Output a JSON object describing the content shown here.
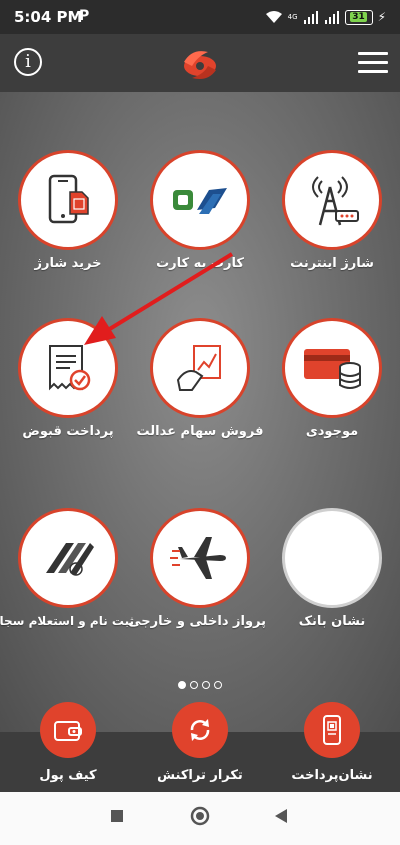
{
  "status": {
    "time": "5:04 PM",
    "network": "4G",
    "battery": "31"
  },
  "tiles": [
    {
      "label": "خرید شارژ"
    },
    {
      "label": "کارت به کارت"
    },
    {
      "label": "شارژ اینترنت"
    },
    {
      "label": "پرداخت قبوض"
    },
    {
      "label": "فروش سهام عدالت"
    },
    {
      "label": "موجودی"
    },
    {
      "label": "ثبت نام و استعلام سجام"
    },
    {
      "label": "پرواز داخلی و خارجی"
    },
    {
      "label": "نشان بانک"
    }
  ],
  "bottom": {
    "wallet_label": "کیف پول",
    "repeat_label": "تکرار تراکنش",
    "pay_label": "نشان‌پرداخت"
  },
  "colors": {
    "accent": "#e0432c",
    "bar": "#3d3d3d"
  },
  "pager": {
    "count": 4,
    "active": 1
  }
}
